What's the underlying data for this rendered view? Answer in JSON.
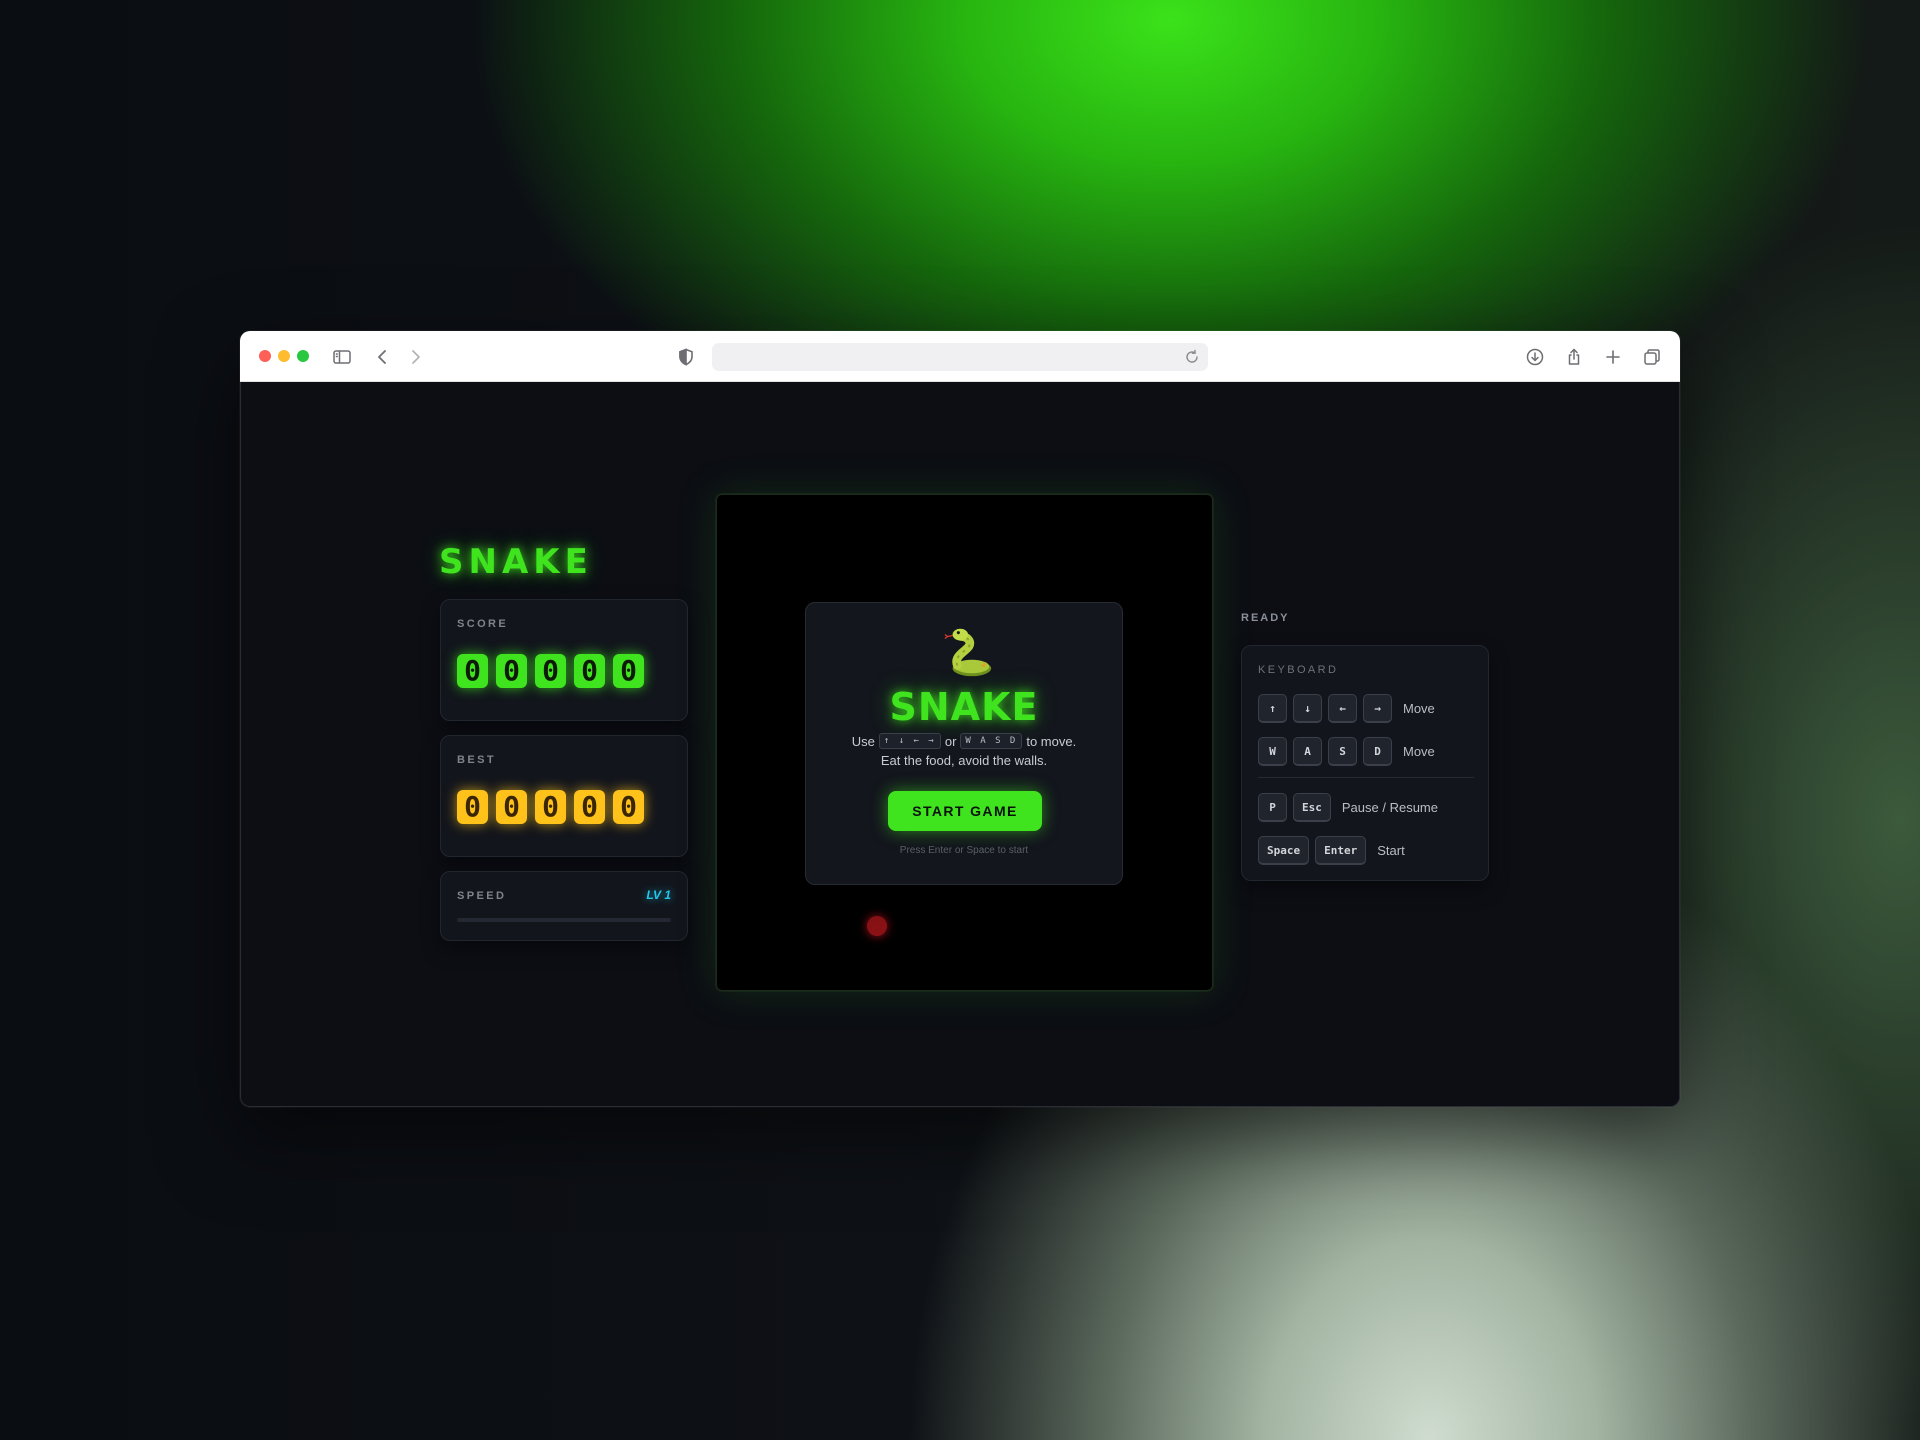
{
  "browser": {
    "url": "",
    "icons": [
      "sidebar-icon",
      "back-icon",
      "forward-icon",
      "shield-icon",
      "reload-icon",
      "download-icon",
      "share-icon",
      "new-tab-icon",
      "tabs-overview-icon"
    ]
  },
  "app": {
    "logo": "SNAKE",
    "accent_color": "#3fe41f",
    "best_color": "#ffc21a",
    "speed_color": "#22c8ec"
  },
  "score": {
    "label": "SCORE",
    "digits": [
      "0",
      "0",
      "0",
      "0",
      "0"
    ]
  },
  "best": {
    "label": "BEST",
    "digits": [
      "0",
      "0",
      "0",
      "0",
      "0"
    ]
  },
  "speed": {
    "label": "SPEED",
    "level": "LV 1",
    "progress": 0
  },
  "overlay": {
    "icon": "snake-emoji",
    "title": "SNAKE",
    "line1_prefix": "Use",
    "arrow_keys": "↑ ↓ ← →",
    "line1_or": "or",
    "wasd_keys": "W A S D",
    "line1_suffix": "to move.",
    "line2": "Eat the food, avoid the walls.",
    "start_label": "START GAME",
    "hint": "Press Enter or Space to start"
  },
  "status": "READY",
  "keyboard": {
    "title": "KEYBOARD",
    "rows": [
      {
        "keys": [
          "↑",
          "↓",
          "←",
          "→"
        ],
        "action": "Move"
      },
      {
        "keys": [
          "W",
          "A",
          "S",
          "D"
        ],
        "action": "Move"
      },
      {
        "keys": [
          "P",
          "Esc"
        ],
        "action": "Pause / Resume"
      },
      {
        "keys": [
          "Space",
          "Enter"
        ],
        "action": "Start"
      }
    ]
  }
}
